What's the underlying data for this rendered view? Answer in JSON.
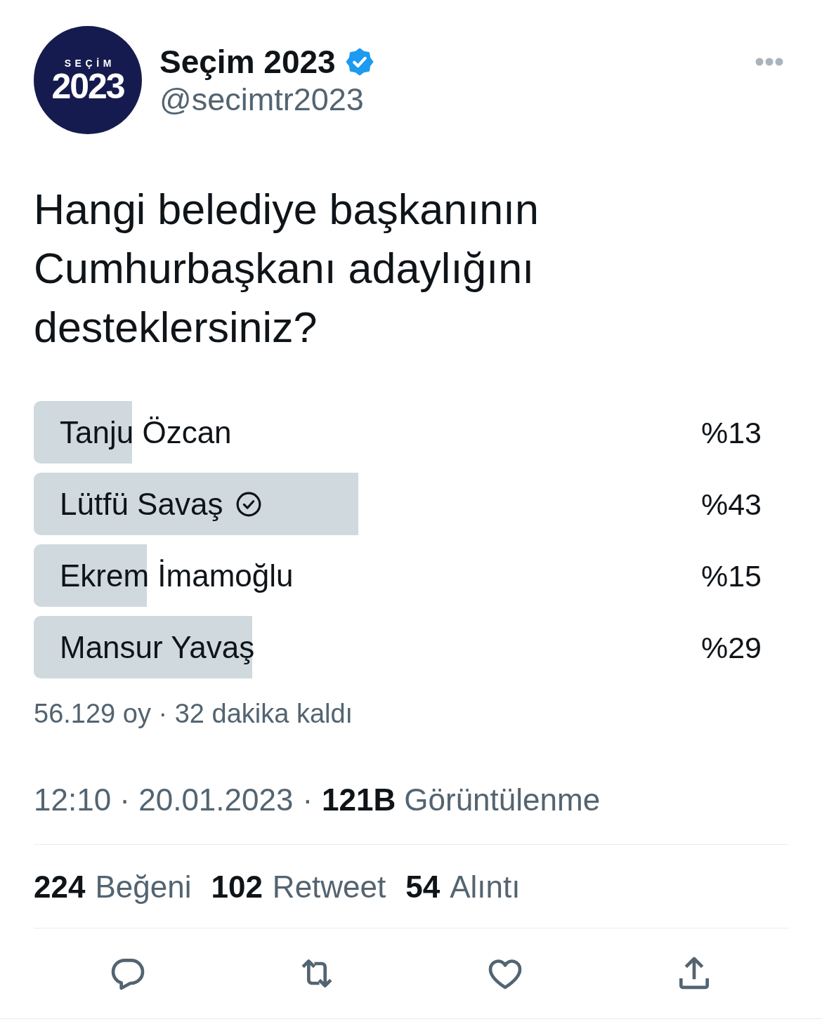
{
  "tweet": {
    "author": {
      "avatar": {
        "kicker": "SEÇİM",
        "year": "2023"
      },
      "name": "Seçim 2023",
      "verified": true,
      "handle": "@secimtr2023"
    },
    "text": "Hangi belediye başkanının\nCumhurbaşkanı adaylığını\ndesteklersiniz?",
    "poll": {
      "options": [
        {
          "label": "Tanju Özcan",
          "percent": "%13",
          "level": 0.13,
          "selected": false
        },
        {
          "label": "Lütfü Savaş",
          "percent": "%43",
          "level": 0.43,
          "selected": true
        },
        {
          "label": "Ekrem İmamoğlu",
          "percent": "%15",
          "level": 0.15,
          "selected": false
        },
        {
          "label": "Mansur Yavaş",
          "percent": "%29",
          "level": 0.29,
          "selected": false
        }
      ],
      "summary": "56.129 oy · 32 dakika kaldı"
    },
    "meta": {
      "timestamp": "12:10 · 20.01.2023",
      "separator": "·",
      "views": {
        "count": "121B",
        "label": "Görüntülenme"
      }
    },
    "stats": [
      {
        "count": "224",
        "label": "Beğeni"
      },
      {
        "count": "102",
        "label": "Retweet"
      },
      {
        "count": "54",
        "label": "Alıntı"
      }
    ]
  }
}
